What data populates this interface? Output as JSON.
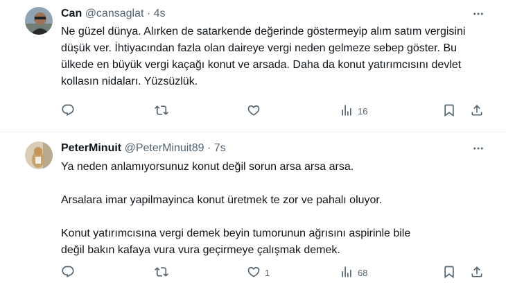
{
  "tweets": [
    {
      "name": "Can",
      "handle": "@cansaglat",
      "separator": "·",
      "time": "4s",
      "paragraphs": [
        "Ne güzel dünya. Alırken de satarkende değerinde göstermeyip alım satım vergisini düşük ver. İhtiyacından fazla olan daireye vergi neden gelmeze sebep göster. Bu ülkede en büyük vergi kaçağı konut ve arsada. Daha da konut yatırımcısını devlet kollasın nidaları. Yüzsüzlük."
      ],
      "replies": "",
      "retweets": "",
      "likes": "",
      "views": "16"
    },
    {
      "name": "PeterMinuit",
      "handle": "@PeterMinuit89",
      "separator": "·",
      "time": "7s",
      "paragraphs": [
        "Ya neden anlamıyorsunuz konut değil sorun arsa arsa arsa.",
        "Arsalara imar yapilmayinca konut üretmek te zor ve pahalı oluyor.",
        "Konut yatırımcısına vergi demek beyin tumorunun ağrısını aspirinle bile\ndeğil bakın kafaya vura vura geçirmeye çalışmak demek."
      ],
      "replies": "",
      "retweets": "",
      "likes": "1",
      "views": "68"
    }
  ],
  "icons": {
    "reply": "reply-icon",
    "retweet": "retweet-icon",
    "like": "heart-icon",
    "views": "views-icon",
    "bookmark": "bookmark-icon",
    "share": "share-icon",
    "more": "more-icon"
  },
  "colors": {
    "text": "#0f1419",
    "secondary": "#536471",
    "divider": "#eff3f4"
  }
}
